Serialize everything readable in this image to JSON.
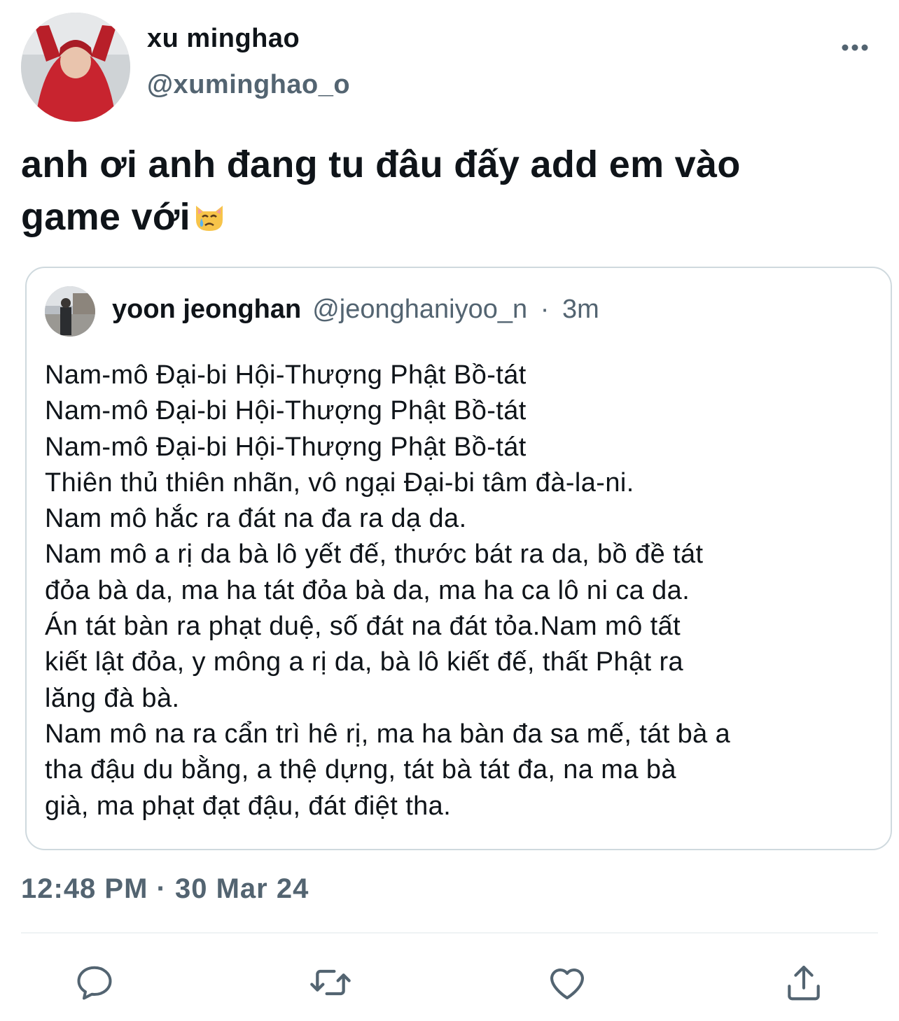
{
  "author": {
    "name": "xu minghao",
    "handle": "@xuminghao_o",
    "avatar": "avatar-red-hoodie-photo"
  },
  "tweet": {
    "text": "anh ơi anh đang tu đâu đấy add em vào game với",
    "emoji": "crying-cat-face-emoji"
  },
  "quoted": {
    "name": "yoon jeonghan",
    "handle": "@jeonghaniyoo_n",
    "separator": "·",
    "time": "3m",
    "avatar": "avatar-street-photo",
    "lines": [
      "Nam-mô Đại-bi Hội-Thượng Phật Bồ-tát",
      "Nam-mô Đại-bi Hội-Thượng Phật Bồ-tát",
      "Nam-mô Đại-bi Hội-Thượng Phật Bồ-tát",
      "Thiên thủ thiên nhãn, vô ngại Đại-bi tâm đà-la-ni.",
      "Nam mô hắc ra đát na đa ra dạ da.",
      "Nam mô a rị da bà lô yết đế, thước bát ra da, bồ đề tát",
      "đỏa bà da, ma ha tát đỏa bà da, ma ha ca lô ni ca da.",
      "Án tát bàn ra phạt duệ, số đát na đát tỏa.Nam mô tất",
      "kiết lật đỏa, y mông a rị da, bà lô kiết đế, thất Phật ra",
      "lăng đà bà.",
      "Nam mô na ra cẩn trì hê rị, ma ha bàn đa sa mế, tát bà a",
      "tha đậu du bằng, a thệ dựng, tát bà tát đa, na ma bà",
      "già, ma phạt đạt đậu, đát điệt tha."
    ]
  },
  "timestamp": "12:48 PM · 30 Mar 24",
  "actions": [
    {
      "icon": "reply-icon"
    },
    {
      "icon": "retweet-icon"
    },
    {
      "icon": "like-icon"
    },
    {
      "icon": "share-icon"
    }
  ],
  "colors": {
    "text": "#0f1419",
    "secondary": "#536471",
    "border": "#cfd9de",
    "background": "#ffffff"
  }
}
